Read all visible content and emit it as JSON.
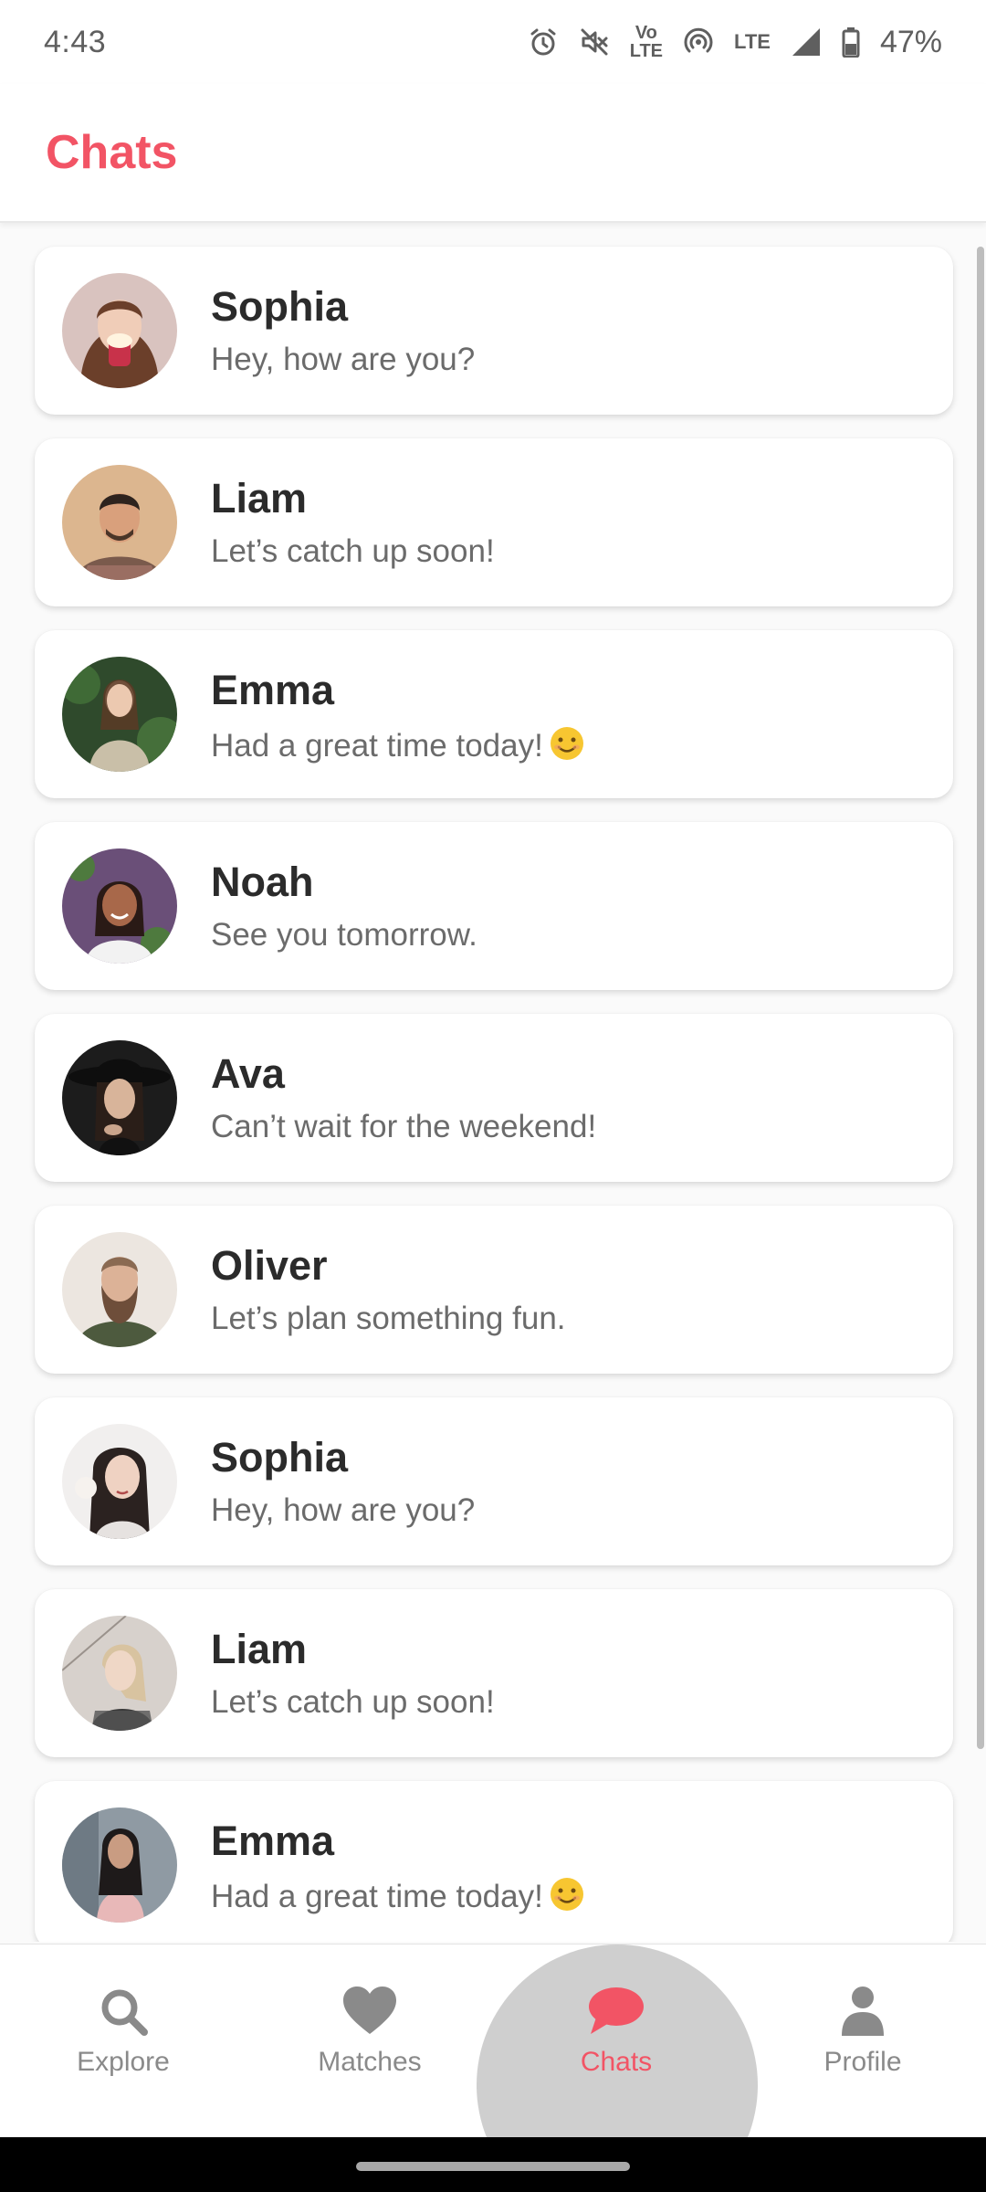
{
  "status_bar": {
    "time": "4:43",
    "lte_top": "Vo",
    "lte_bottom": "LTE",
    "network": "LTE",
    "battery": "47%"
  },
  "app_bar": {
    "title": "Chats"
  },
  "chats": [
    {
      "name": "Sophia",
      "message": "Hey, how are you?",
      "emoji": ""
    },
    {
      "name": "Liam",
      "message": "Let’s catch up soon!",
      "emoji": ""
    },
    {
      "name": "Emma",
      "message": "Had a great time today!",
      "emoji": "😊"
    },
    {
      "name": "Noah",
      "message": "See you tomorrow.",
      "emoji": ""
    },
    {
      "name": "Ava",
      "message": "Can’t wait for the weekend!",
      "emoji": ""
    },
    {
      "name": "Oliver",
      "message": "Let’s plan something fun.",
      "emoji": ""
    },
    {
      "name": "Sophia",
      "message": "Hey, how are you?",
      "emoji": ""
    },
    {
      "name": "Liam",
      "message": "Let’s catch up soon!",
      "emoji": ""
    },
    {
      "name": "Emma",
      "message": "Had a great time today!",
      "emoji": "😊"
    }
  ],
  "bottom_nav": [
    {
      "label": "Explore",
      "icon": "search-icon",
      "active": false
    },
    {
      "label": "Matches",
      "icon": "heart-icon",
      "active": false
    },
    {
      "label": "Chats",
      "icon": "chat-bubble-icon",
      "active": true
    },
    {
      "label": "Profile",
      "icon": "person-icon",
      "active": false
    }
  ],
  "colors": {
    "accent": "#f25465",
    "nav_inactive": "#8a8a8a",
    "nav_highlight": "#cfcfcf"
  }
}
